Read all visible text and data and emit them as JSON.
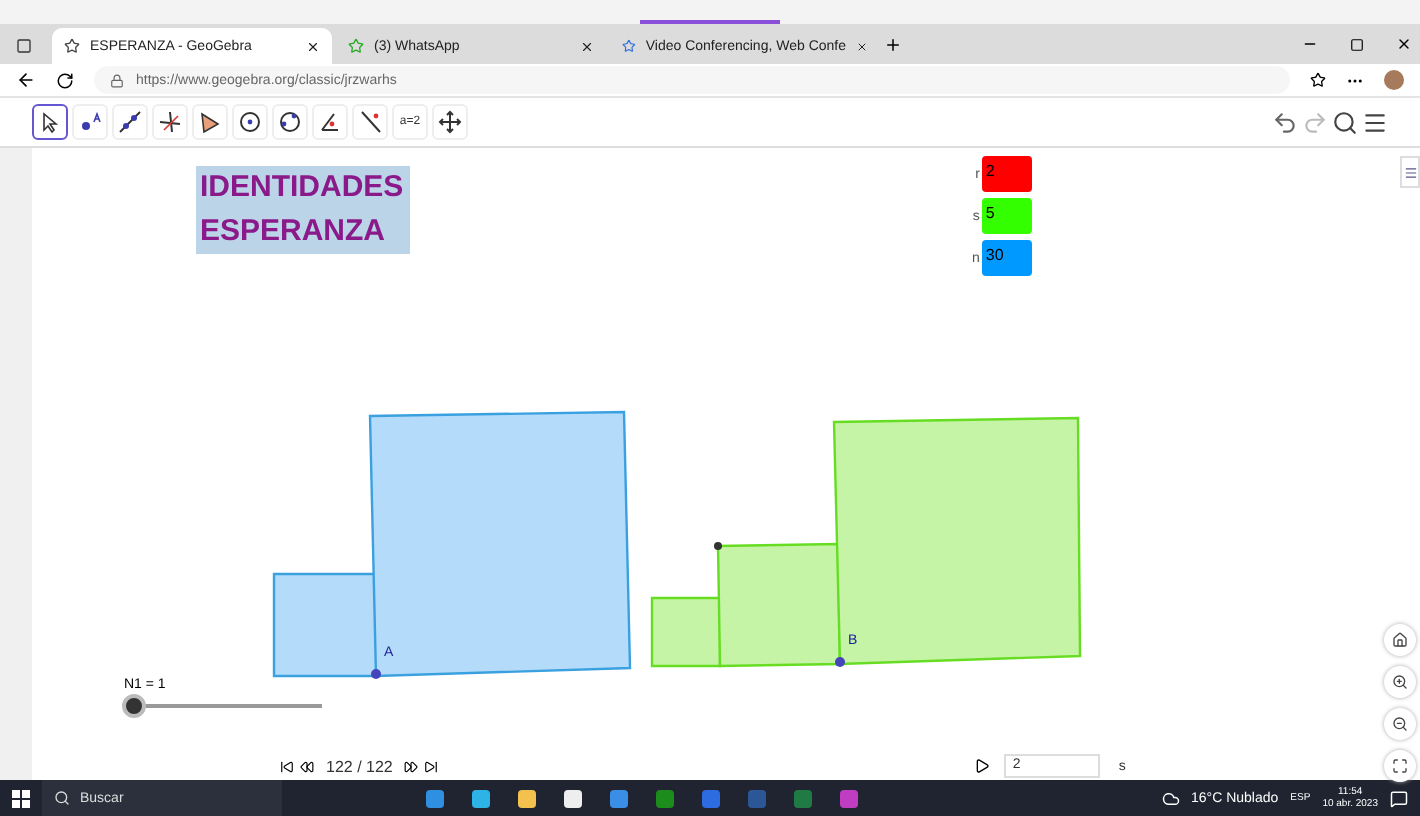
{
  "browser": {
    "tabs": [
      {
        "title": "ESPERANZA - GeoGebra",
        "selected": true
      },
      {
        "title": "(3) WhatsApp",
        "selected": false
      },
      {
        "title": "Video Conferencing, Web Confe",
        "selected": false
      }
    ],
    "address": "https://www.geogebra.org/classic/jrzwarhs"
  },
  "toolbar": {
    "tools": [
      {
        "kind": "move",
        "selected": true
      },
      {
        "kind": "point",
        "selected": false
      },
      {
        "kind": "line",
        "selected": false
      },
      {
        "kind": "perpendicular",
        "selected": false
      },
      {
        "kind": "polygon",
        "selected": false
      },
      {
        "kind": "circle",
        "selected": false
      },
      {
        "kind": "ellipse",
        "selected": false
      },
      {
        "kind": "angle",
        "selected": false
      },
      {
        "kind": "reflect",
        "selected": false
      },
      {
        "kind": "slider",
        "selected": false,
        "label": "a=2"
      },
      {
        "kind": "pan",
        "selected": false
      }
    ]
  },
  "canvas": {
    "title_lines": [
      "IDENTIDADES",
      "ESPERANZA"
    ],
    "inputs": [
      {
        "label": "r",
        "value": "2",
        "color": "#ff0000"
      },
      {
        "label": "s",
        "value": "5",
        "color": "#33ff00"
      },
      {
        "label": "n",
        "value": "30",
        "color": "#0099ff"
      }
    ],
    "points": [
      {
        "label": "A"
      },
      {
        "label": "B"
      }
    ],
    "slider": {
      "label": "N1 = 1",
      "level": 0
    }
  },
  "playbar": {
    "frame": "122 / 122",
    "speed": "2",
    "unit": "s"
  },
  "taskbar": {
    "search_placeholder": "Buscar",
    "weather": "16°C Nublado",
    "language": "ESP",
    "time": "11:54",
    "date": "10 abr. 2023"
  }
}
